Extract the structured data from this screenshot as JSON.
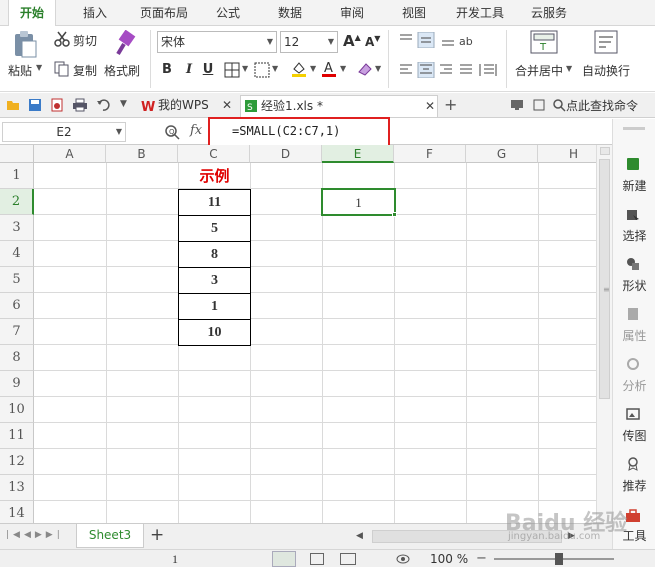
{
  "menu": {
    "tabs": [
      "开始",
      "插入",
      "页面布局",
      "公式",
      "数据",
      "审阅",
      "视图",
      "开发工具",
      "云服务"
    ],
    "active": "开始"
  },
  "ribbon": {
    "paste_label": "粘贴",
    "cut_label": "剪切",
    "copy_label": "复制",
    "format_painter_label": "格式刷",
    "font_name": "宋体",
    "font_size": "12",
    "bold": "B",
    "italic": "I",
    "underline": "U",
    "merge_label": "合并居中",
    "wrap_label": "自动换行"
  },
  "doc_tabs": {
    "wps_label": "我的WPS",
    "file_label": "经验1.xls *",
    "search_label": "点此查找命令"
  },
  "formula_bar": {
    "cell_ref": "E2",
    "fx_label": "fx",
    "formula": "=SMALL(C2:C7,1)"
  },
  "sheet": {
    "columns": [
      "A",
      "B",
      "C",
      "D",
      "E",
      "F",
      "G",
      "H"
    ],
    "rows": [
      "1",
      "2",
      "3",
      "4",
      "5",
      "6",
      "7",
      "8",
      "9",
      "10",
      "11",
      "12",
      "13",
      "14"
    ],
    "example_title": "示例",
    "example_values": [
      "11",
      "5",
      "8",
      "3",
      "1",
      "10"
    ],
    "result_value": "1"
  },
  "side_panel": {
    "items": [
      {
        "label": "新建",
        "icon": "new-icon"
      },
      {
        "label": "选择",
        "icon": "select-icon"
      },
      {
        "label": "形状",
        "icon": "shape-icon"
      },
      {
        "label": "属性",
        "icon": "properties-icon"
      },
      {
        "label": "分析",
        "icon": "analyze-icon"
      },
      {
        "label": "传图",
        "icon": "upload-image-icon"
      },
      {
        "label": "推荐",
        "icon": "recommend-icon"
      },
      {
        "label": "工具",
        "icon": "toolbox-icon"
      }
    ]
  },
  "sheet_tabs": {
    "active": "Sheet3",
    "add_symbol": "+"
  },
  "status": {
    "page_number": "1",
    "zoom": "100 %"
  },
  "watermark": {
    "text": "Baidu 经验",
    "url": "jingyan.baidu.com"
  },
  "colors": {
    "accent_green": "#2e8b2e",
    "highlight_red": "#e02020",
    "title_red": "#e00000"
  }
}
